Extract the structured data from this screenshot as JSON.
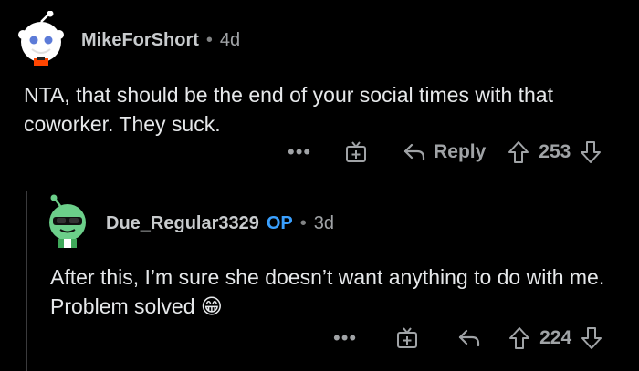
{
  "comments": [
    {
      "username": "MikeForShort",
      "separator": "•",
      "age": "4d",
      "body": "NTA, that should be the end of your social times with that coworker. They suck.",
      "more": "•••",
      "reply_label": "Reply",
      "score": "253",
      "avatar_icon": "snoo-avatar-icon"
    },
    {
      "username": "Due_Regular3329",
      "op_badge": "OP",
      "separator": "•",
      "age": "3d",
      "body": "After this, I’m sure she doesn’t want anything to do with me. Problem solved 😁",
      "more": "•••",
      "score": "224",
      "avatar_icon": "snoo-avatar-icon"
    }
  ],
  "colors": {
    "background": "#000000",
    "text": "#d7dadc",
    "muted": "#a0a3a6",
    "op": "#3aa0ff"
  }
}
